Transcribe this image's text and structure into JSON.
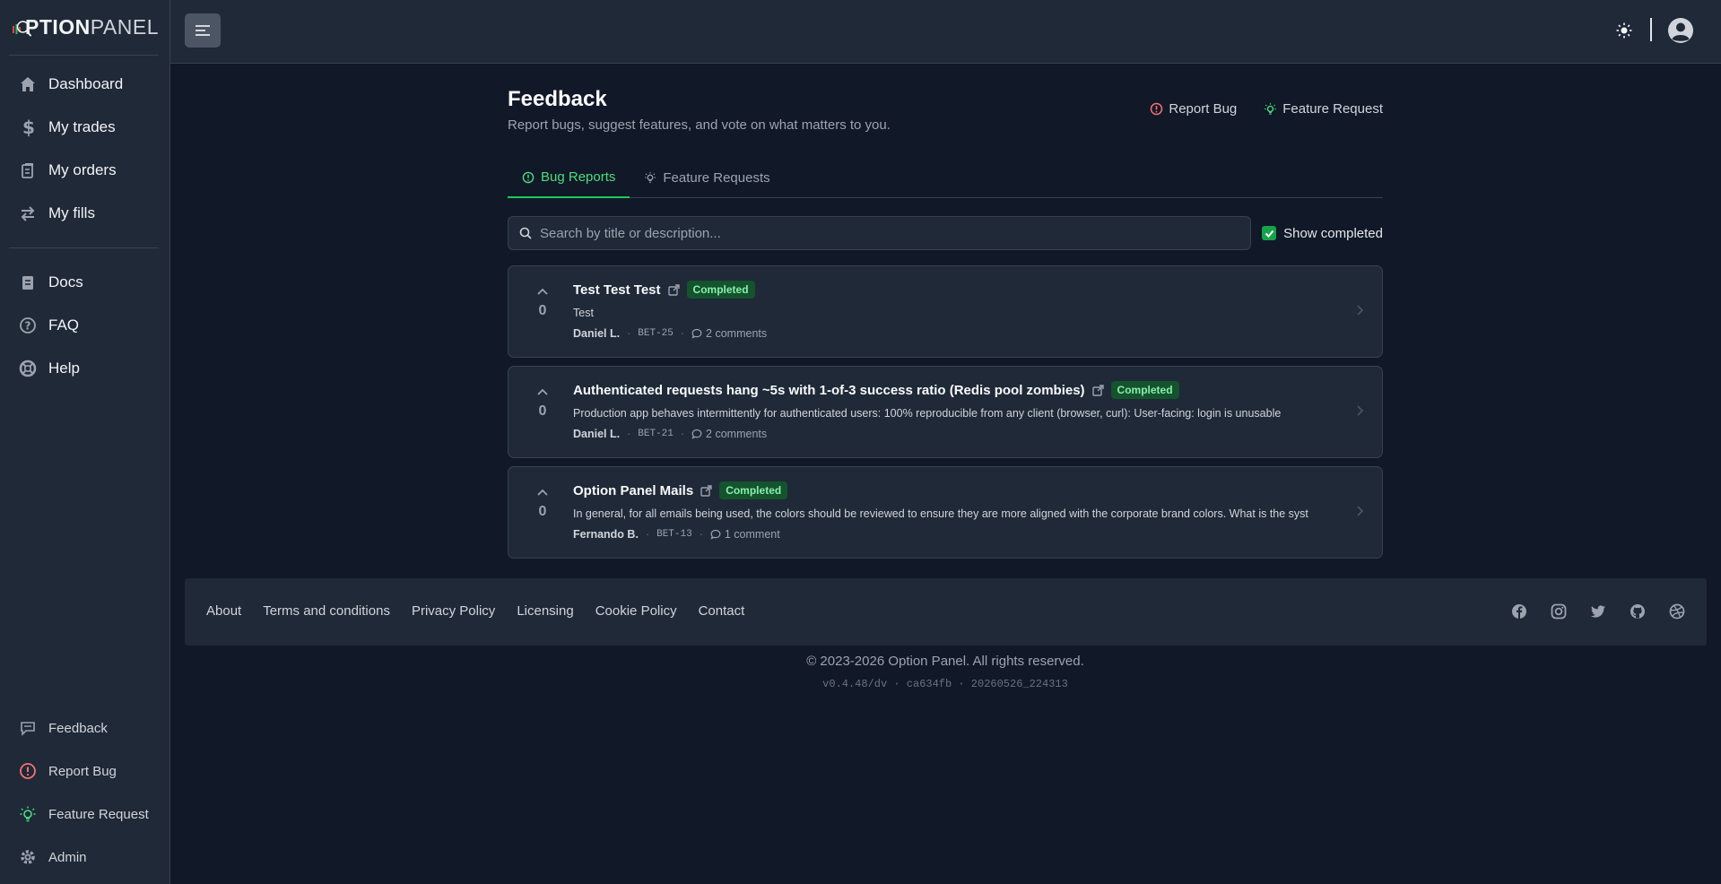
{
  "brand": {
    "logo_text_bold": "PTION",
    "logo_text_light": "PANEL"
  },
  "sidebar": {
    "main_items": [
      {
        "label": "Dashboard",
        "icon": "home-icon"
      },
      {
        "label": "My trades",
        "icon": "dollar-icon"
      },
      {
        "label": "My orders",
        "icon": "clipboard-icon"
      },
      {
        "label": "My fills",
        "icon": "swap-icon"
      }
    ],
    "doc_items": [
      {
        "label": "Docs",
        "icon": "docs-icon"
      },
      {
        "label": "FAQ",
        "icon": "question-icon"
      },
      {
        "label": "Help",
        "icon": "lifebuoy-icon"
      }
    ],
    "bottom_items": [
      {
        "label": "Feedback",
        "icon": "chat-icon"
      },
      {
        "label": "Report Bug",
        "icon": "alert-icon"
      },
      {
        "label": "Feature Request",
        "icon": "lightbulb-icon"
      },
      {
        "label": "Admin",
        "icon": "gear-icon"
      }
    ]
  },
  "page": {
    "title": "Feedback",
    "subtitle": "Report bugs, suggest features, and vote on what matters to you.",
    "actions": {
      "report_bug": "Report Bug",
      "feature_request": "Feature Request"
    }
  },
  "tabs": [
    {
      "label": "Bug Reports",
      "active": true
    },
    {
      "label": "Feature Requests",
      "active": false
    }
  ],
  "search": {
    "placeholder": "Search by title or description...",
    "value": ""
  },
  "filter": {
    "show_completed_label": "Show completed",
    "checked": true
  },
  "items": [
    {
      "title": "Test Test Test",
      "status": "Completed",
      "description": "Test",
      "author": "Daniel L.",
      "code": "BET-25",
      "comments": "2 comments",
      "votes": "0"
    },
    {
      "title": "Authenticated requests hang ~5s with 1-of-3 success ratio (Redis pool zombies)",
      "status": "Completed",
      "description": "Production app behaves intermittently for authenticated users: 100% reproducible from any client (browser, curl): User-facing: login is unusable",
      "author": "Daniel L.",
      "code": "BET-21",
      "comments": "2 comments",
      "votes": "0"
    },
    {
      "title": "Option Panel Mails",
      "status": "Completed",
      "description": "In general, for all emails being used, the colors should be reviewed to ensure they are more aligned with the corporate brand colors. What is the syst",
      "author": "Fernando B.",
      "code": "BET-13",
      "comments": "1 comment",
      "votes": "0"
    }
  ],
  "footer": {
    "links": [
      "About",
      "Terms and conditions",
      "Privacy Policy",
      "Licensing",
      "Cookie Policy",
      "Contact"
    ],
    "socials": [
      "facebook-icon",
      "instagram-icon",
      "twitter-icon",
      "github-icon",
      "dribbble-icon"
    ],
    "copyright": "© 2023-2026 Option Panel. All rights reserved.",
    "version": "v0.4.48/dv · ca634fb · 20260526_224313"
  },
  "colors": {
    "accent": "#22c55e",
    "bug": "#f87171",
    "feature": "#4ade80",
    "background": "#111827",
    "panel": "#1f2937"
  }
}
